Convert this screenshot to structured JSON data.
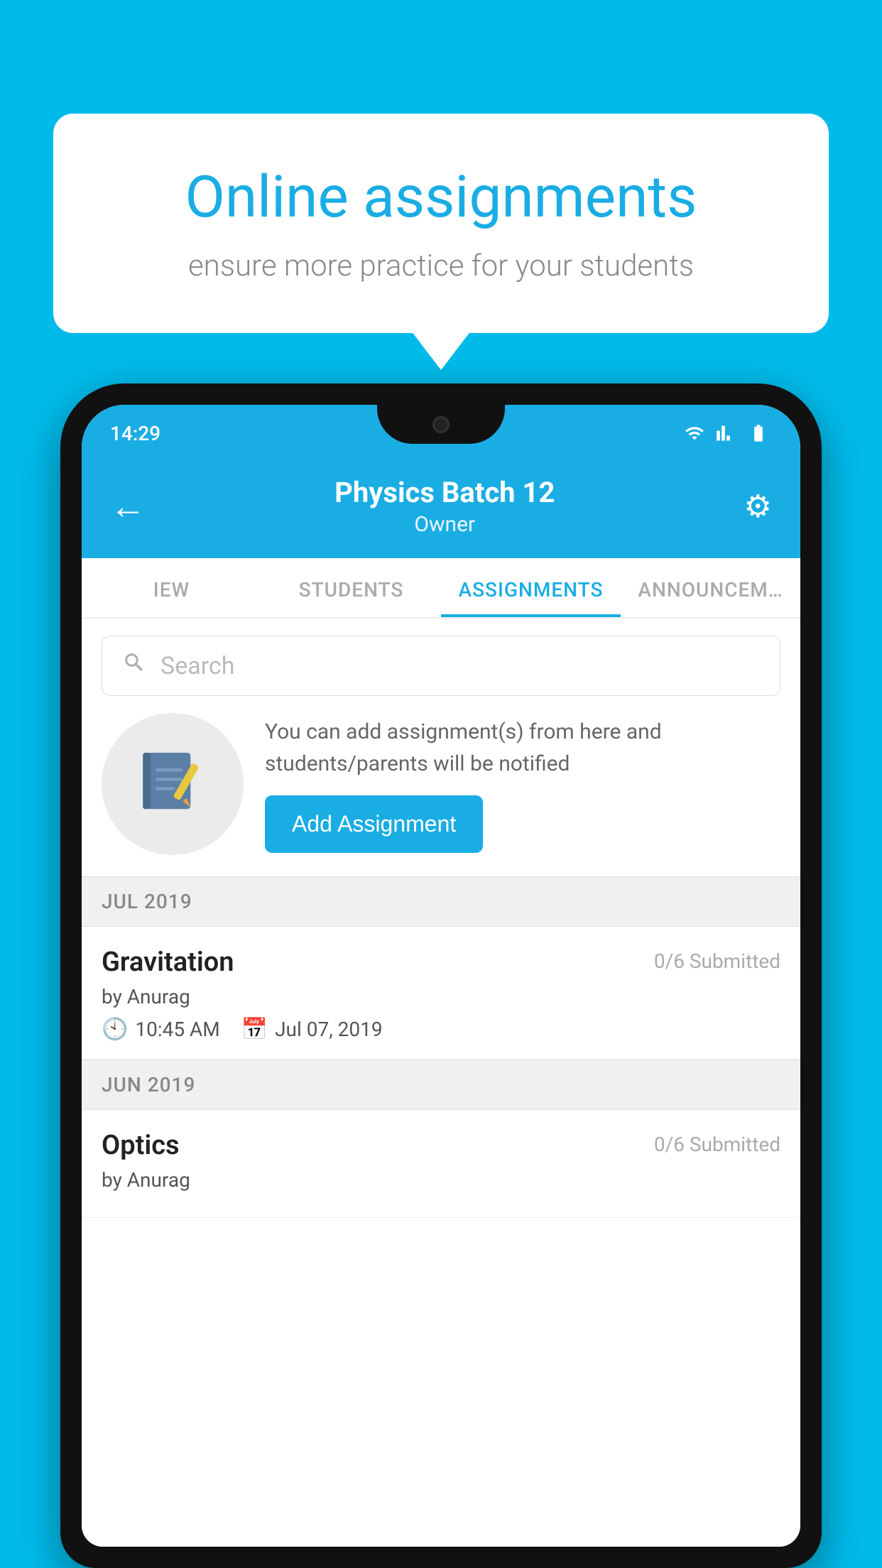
{
  "background_color": "#00BBEA",
  "speech_bubble": {
    "title": "Online assignments",
    "subtitle": "ensure more practice for your students"
  },
  "status_bar": {
    "time": "14:29",
    "icons": [
      "wifi",
      "signal",
      "battery"
    ]
  },
  "header": {
    "title": "Physics Batch 12",
    "subtitle": "Owner",
    "back_label": "←",
    "settings_label": "⚙"
  },
  "tabs": [
    {
      "label": "IEW",
      "active": false
    },
    {
      "label": "STUDENTS",
      "active": false
    },
    {
      "label": "ASSIGNMENTS",
      "active": true
    },
    {
      "label": "ANNOUNCEM…",
      "active": false
    }
  ],
  "search": {
    "placeholder": "Search"
  },
  "promo": {
    "description": "You can add assignment(s) from here and students/parents will be notified",
    "button_label": "Add Assignment"
  },
  "sections": [
    {
      "month": "JUL 2019",
      "assignments": [
        {
          "title": "Gravitation",
          "submitted": "0/6 Submitted",
          "by": "by Anurag",
          "time": "10:45 AM",
          "date": "Jul 07, 2019"
        }
      ]
    },
    {
      "month": "JUN 2019",
      "assignments": [
        {
          "title": "Optics",
          "submitted": "0/6 Submitted",
          "by": "by Anurag",
          "time": "",
          "date": ""
        }
      ]
    }
  ]
}
